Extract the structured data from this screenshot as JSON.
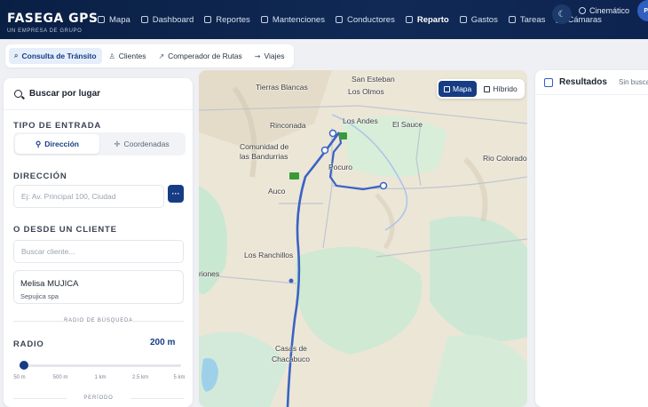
{
  "brand": {
    "name": "FASEGA GPS",
    "tagline": "UN EMPRESA DE GRUPO"
  },
  "nav": [
    {
      "label": "Mapa",
      "icon": "map-icon"
    },
    {
      "label": "Dashboard",
      "icon": "dashboard-icon"
    },
    {
      "label": "Reportes",
      "icon": "reports-icon"
    },
    {
      "label": "Mantenciones",
      "icon": "wrench-icon"
    },
    {
      "label": "Conductores",
      "icon": "drivers-icon"
    },
    {
      "label": "Reparto",
      "icon": "delivery-icon"
    },
    {
      "label": "Gastos",
      "icon": "expenses-icon"
    },
    {
      "label": "Tareas",
      "icon": "tasks-icon"
    },
    {
      "label": "Cámaras",
      "icon": "camera-icon"
    }
  ],
  "header_right": {
    "theme_icon": "moon-icon",
    "mode_label": "Cinemático",
    "avatar_initials": "PA"
  },
  "subtabs": [
    {
      "label": "Consulta de Tránsito",
      "icon": "search-icon"
    },
    {
      "label": "Clientes",
      "icon": "users-icon"
    },
    {
      "label": "Comperador de Rutas",
      "icon": "route-icon"
    },
    {
      "label": "Viajes",
      "icon": "trips-icon"
    }
  ],
  "left_panel": {
    "title": "Buscar por lugar",
    "entry_type_label": "TIPO DE ENTRADA",
    "entry_options": [
      "Dirección",
      "Coordenadas"
    ],
    "entry_selected": "Dirección",
    "address_label": "DIRECCIÓN",
    "address_placeholder": "Ej: Av. Principal 100, Ciudad",
    "more_button": "···",
    "client_label": "O DESDE UN CLIENTE",
    "client_placeholder": "Buscar cliente...",
    "client": {
      "name": "Melisa MUJICA",
      "company": "Sepujica spa"
    },
    "radius_section": "RADIO DE BÚSQUEDA",
    "radius_label": "RADIO",
    "radius_value": "200 m",
    "radius_fraction": 0.03,
    "radius_ticks": [
      "50 m",
      "500 m",
      "1 km",
      "2.5 km",
      "5 km"
    ],
    "period_section": "PERÍODO"
  },
  "map": {
    "toggle": [
      {
        "label": "Mapa",
        "active": true
      },
      {
        "label": "Híbrido",
        "active": false
      }
    ],
    "places": [
      "Tierras Blancas",
      "San Esteban",
      "Los Olmos",
      "Los Andes",
      "El Sauce",
      "Rinconada",
      "Comunidad de",
      "las Bandurrias",
      "Pocuro",
      "Rio Colorado",
      "Auco",
      "Los Ranchillos",
      "riones",
      "Casas de",
      "Chacabuco"
    ],
    "road_shields": [
      "57",
      "60",
      "57",
      "57",
      "57",
      "57"
    ]
  },
  "right_panel": {
    "title": "Resultados",
    "subtitle": "Sin busca"
  }
}
